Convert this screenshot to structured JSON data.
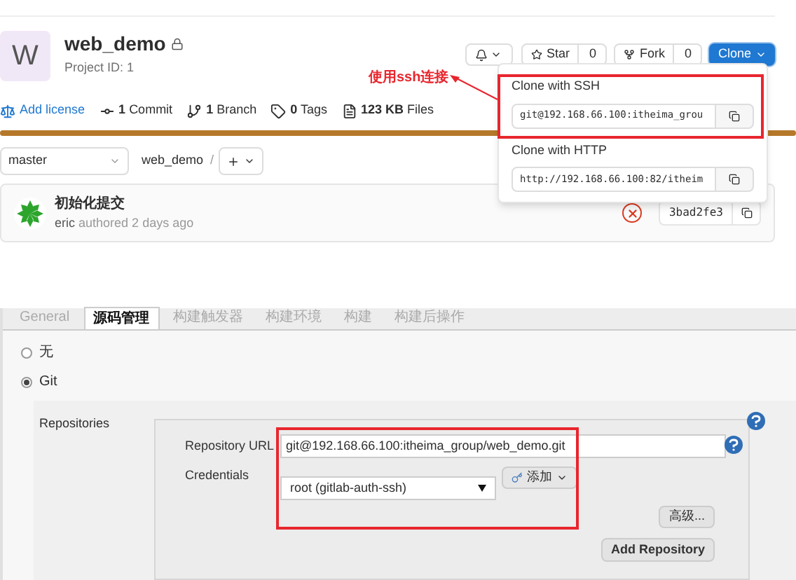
{
  "gitlab": {
    "project": {
      "avatar_letter": "W",
      "name": "web_demo",
      "id_text": "Project ID: 1"
    },
    "actions": {
      "star": {
        "label": "Star",
        "count": "0"
      },
      "fork": {
        "label": "Fork",
        "count": "0"
      },
      "clone": "Clone"
    },
    "stats": [
      {
        "kind": "license",
        "label": "Add license"
      },
      {
        "kind": "commit",
        "value": "1",
        "label": "Commit"
      },
      {
        "kind": "branch",
        "value": "1",
        "label": "Branch"
      },
      {
        "kind": "tag",
        "value": "0",
        "label": "Tags"
      },
      {
        "kind": "files",
        "value": "123 KB",
        "label": "Files"
      }
    ],
    "annotation": "使用ssh连接",
    "clone_menu": [
      {
        "title": "Clone with SSH",
        "value": "git@192.168.66.100:itheima_grou",
        "highlighted": true
      },
      {
        "title": "Clone with HTTP",
        "value": "http://192.168.66.100:82/itheim",
        "highlighted": false
      }
    ],
    "branch": "master",
    "path": "web_demo",
    "path_sep": "/",
    "commit": {
      "title": "初始化提交",
      "author": "eric",
      "meta": "authored 2 days ago",
      "pipeline_failed": true,
      "sha": "3bad2fe3"
    }
  },
  "jenkins": {
    "tabs": [
      {
        "label": "General",
        "selected": false
      },
      {
        "label": "源码管理",
        "selected": true
      },
      {
        "label": "构建触发器",
        "selected": false
      },
      {
        "label": "构建环境",
        "selected": false
      },
      {
        "label": "构建",
        "selected": false
      },
      {
        "label": "构建后操作",
        "selected": false
      }
    ],
    "scm_options": [
      {
        "label": "无",
        "selected": false
      },
      {
        "label": "Git",
        "selected": true
      }
    ],
    "repositories_label": "Repositories",
    "repository_url_label": "Repository URL",
    "repository_url": "git@192.168.66.100:itheima_group/web_demo.git",
    "credentials_label": "Credentials",
    "credentials": "root (gitlab-auth-ssh)",
    "add_button": "添加",
    "advanced_button": "高级...",
    "add_repository_button": "Add Repository"
  }
}
